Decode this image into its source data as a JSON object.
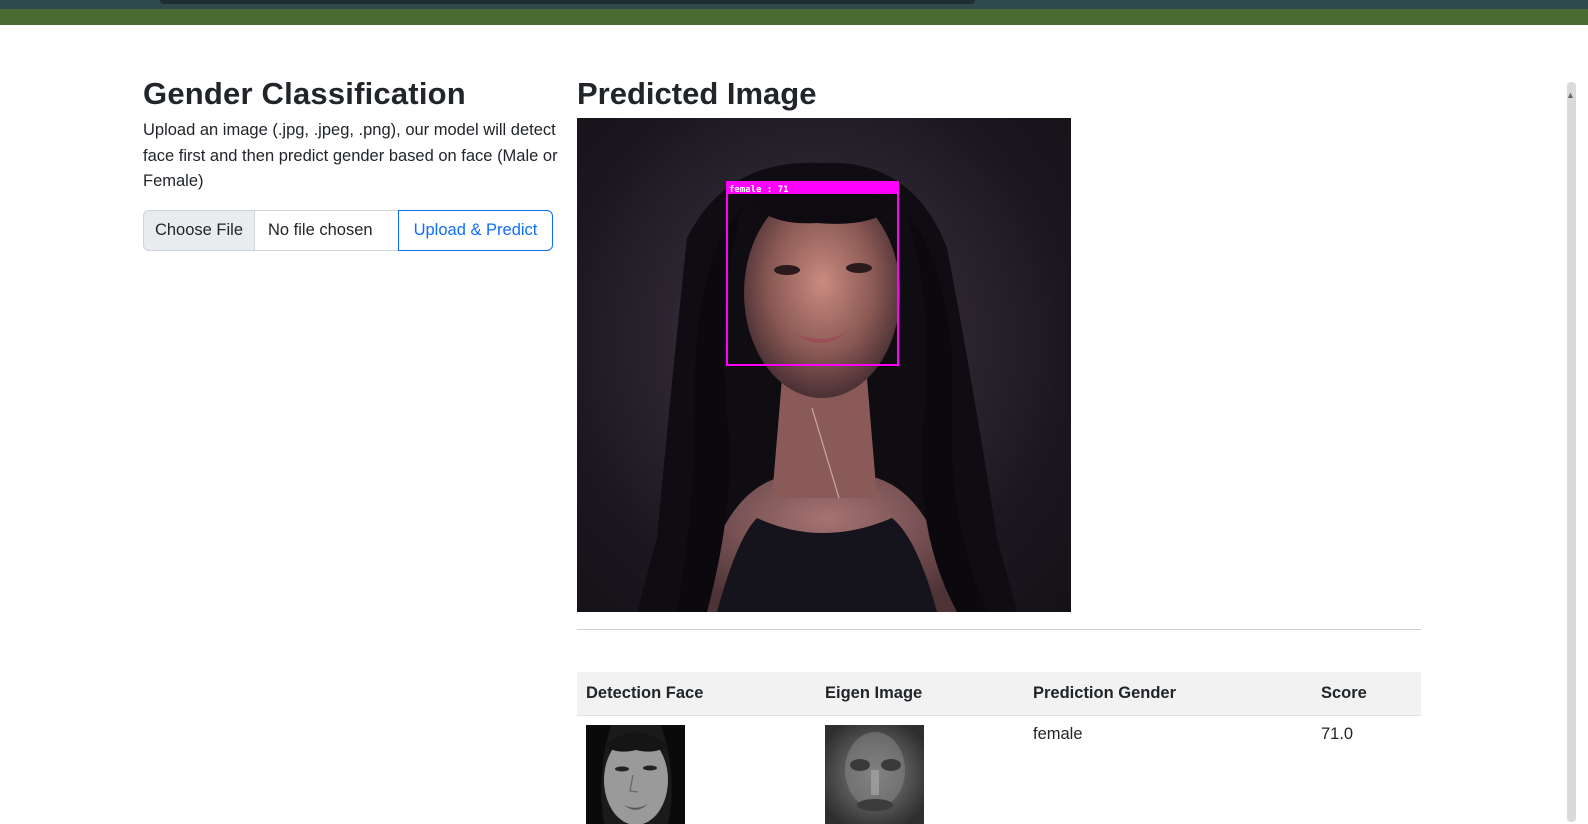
{
  "left": {
    "title": "Gender Classification",
    "description": "Upload an image (.jpg, .jpeg, .png), our model will detect face first and then predict gender based on face (Male or Female)",
    "choose_file_label": "Choose File",
    "no_file_label": "No file chosen",
    "upload_button_label": "Upload & Predict"
  },
  "right": {
    "title": "Predicted Image",
    "face_box_label": "female : 71",
    "box_color": "#ff00ff"
  },
  "table": {
    "headers": [
      "Detection Face",
      "Eigen Image",
      "Prediction Gender",
      "Score"
    ],
    "rows": [
      {
        "prediction_gender": "female",
        "score": "71.0"
      }
    ]
  },
  "colors": {
    "topbar": "#4a6b34",
    "topbar_strip": "#2f4a4f",
    "primary": "#0d6efd"
  }
}
